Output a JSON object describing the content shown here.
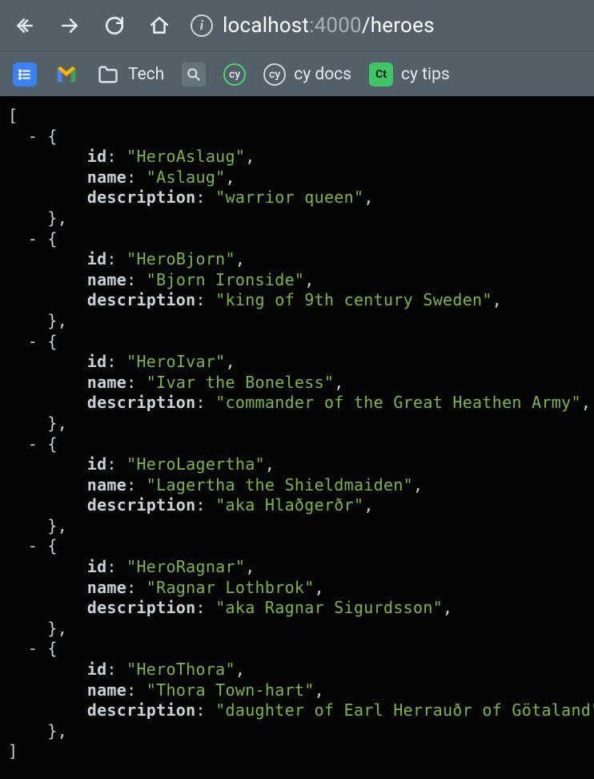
{
  "toolbar": {
    "url_host": "localhost",
    "url_port": ":4000",
    "url_path": "/heroes"
  },
  "bookmarks": {
    "tech_label": "Tech",
    "cy_docs_label": "cy docs",
    "cy_tips_label": "cy tips"
  },
  "json": {
    "open_bracket": "[",
    "close_bracket": "]",
    "dash": "-",
    "brace_open": "{",
    "brace_close_comma": "},",
    "key_id": "id",
    "key_name": "name",
    "key_description": "description",
    "items": [
      {
        "id": "HeroAslaug",
        "name": "Aslaug",
        "description": "warrior queen"
      },
      {
        "id": "HeroBjorn",
        "name": "Bjorn Ironside",
        "description": "king of 9th century Sweden"
      },
      {
        "id": "HeroIvar",
        "name": "Ivar the Boneless",
        "description": "commander of the Great Heathen Army"
      },
      {
        "id": "HeroLagertha",
        "name": "Lagertha the Shieldmaiden",
        "description": "aka Hlaðgerðr"
      },
      {
        "id": "HeroRagnar",
        "name": "Ragnar Lothbrok",
        "description": "aka Ragnar Sigurdsson"
      },
      {
        "id": "HeroThora",
        "name": "Thora Town-hart",
        "description": "daughter of Earl Herrauðr of Götaland"
      }
    ]
  }
}
